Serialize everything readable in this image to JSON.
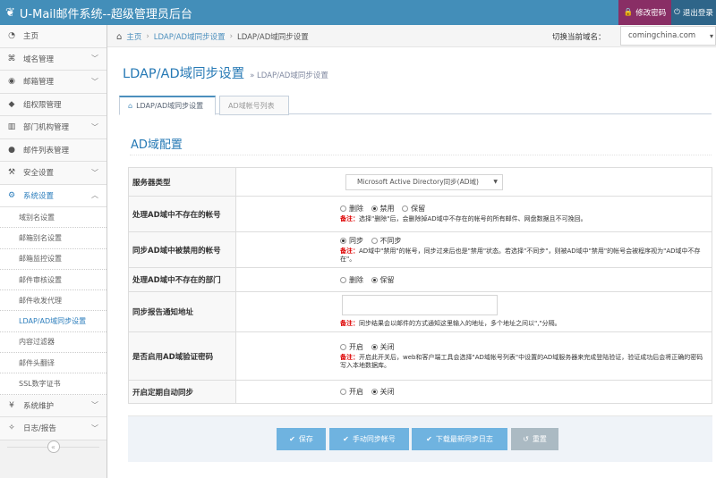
{
  "app": {
    "title": "U-Mail邮件系统--超级管理员后台"
  },
  "topbar": {
    "change_password": "修改密码",
    "logout": "退出登录"
  },
  "sidebar": {
    "items": [
      {
        "icon": "tachometer-icon",
        "label": "主页"
      },
      {
        "icon": "sitemap-icon",
        "label": "域名管理"
      },
      {
        "icon": "globe-icon",
        "label": "邮箱管理"
      },
      {
        "icon": "tags-icon",
        "label": "组权限管理"
      },
      {
        "icon": "bar-chart-icon",
        "label": "部门机构管理"
      },
      {
        "icon": "user-icon",
        "label": "邮件列表管理"
      },
      {
        "icon": "gavel-icon",
        "label": "安全设置"
      },
      {
        "icon": "cog-icon",
        "label": "系统设置"
      }
    ],
    "sub_items": [
      "域别名设置",
      "邮箱别名设置",
      "邮箱监控设置",
      "邮件审核设置",
      "邮件收发代理",
      "LDAP/AD域同步设置",
      "内容过滤器",
      "邮件头翻译",
      "SSL数字证书"
    ],
    "items_after": [
      {
        "icon": "yen-icon",
        "label": "系统维护"
      },
      {
        "icon": "lightbulb-icon",
        "label": "日志/报告"
      }
    ]
  },
  "breadcrumb": {
    "home": "主页",
    "parent": "LDAP/AD域同步设置",
    "current": "LDAP/AD域同步设置"
  },
  "domain_switch": {
    "label": "切换当前域名：",
    "value": "comingchina.com"
  },
  "page": {
    "title": "LDAP/AD域同步设置",
    "subtitle": "» LDAP/AD域同步设置"
  },
  "tabs": [
    {
      "label": "LDAP/AD域同步设置"
    },
    {
      "label": "AD域帐号列表"
    }
  ],
  "section": {
    "title": "AD域配置"
  },
  "form": {
    "server_type": {
      "label": "服务器类型",
      "value": "Microsoft Active Directory同步(AD域)"
    },
    "not_exist_accounts": {
      "label": "处理AD域中不存在的帐号",
      "options": [
        "删除",
        "禁用",
        "保留"
      ],
      "note_prefix": "备注：",
      "note": "选择\"删除\"后，会删除掉AD域中不存在的帐号的所有邮件、网盘数据且不可挽回。"
    },
    "disabled_accounts": {
      "label": "同步AD域中被禁用的帐号",
      "options": [
        "同步",
        "不同步"
      ],
      "note_prefix": "备注：",
      "note": "AD域中\"禁用\"的帐号，同步过来后也是\"禁用\"状态。若选择\"不同步\"，则被AD域中\"禁用\"的帐号会被程序视为\"AD域中不存在\"。"
    },
    "not_exist_departments": {
      "label": "处理AD域中不存在的部门",
      "options": [
        "删除",
        "保留"
      ]
    },
    "report_address": {
      "label": "同步报告通知地址",
      "value": "",
      "note_prefix": "备注：",
      "note": "同步结果会以邮件的方式通知这里输入的地址，多个地址之间以\",\"分隔。"
    },
    "ad_password_auth": {
      "label": "是否启用AD域验证密码",
      "options": [
        "开启",
        "关闭"
      ],
      "note_prefix": "备注：",
      "note": "开启此开关后，web和客户端工具会选择\"AD域帐号列表\"中设置的AD域服务器来完成登陆验证，验证成功后会将正确的密码写入本地数据库。"
    },
    "auto_sync": {
      "label": "开启定期自动同步",
      "options": [
        "开启",
        "关闭"
      ]
    }
  },
  "buttons": {
    "save": "保存",
    "manual_sync": "手动同步帐号",
    "download_log": "下载最新同步日志",
    "reset": "重置"
  },
  "colors": {
    "topbar": "#438eb9",
    "accent": "#2679b5",
    "button": "#6fb3e0",
    "pw_button": "#892e65"
  }
}
